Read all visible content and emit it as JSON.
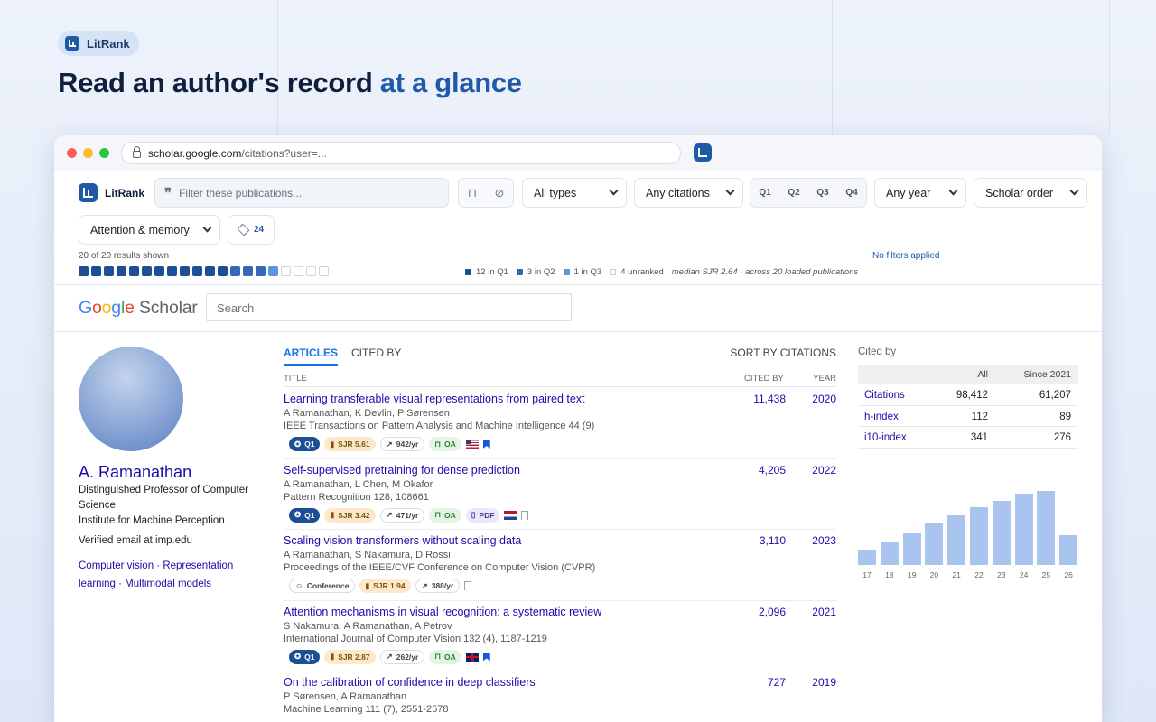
{
  "badge": {
    "label": "LitRank"
  },
  "hero": {
    "title_start": "Read an author's record",
    "title_accent": "at a glance"
  },
  "browser": {
    "url_host": "scholar.google.com",
    "url_path": "/citations?user=..."
  },
  "toolbar": {
    "brand": "LitRank",
    "filter_placeholder": "Filter these publications...",
    "type_select": "All types",
    "citations_select": "Any citations",
    "quartiles": [
      "Q1",
      "Q2",
      "Q3",
      "Q4"
    ],
    "year_select": "Any year",
    "order_select": "Scholar order",
    "topic_select": "Attention & memory",
    "layer_count": "24",
    "results_text": "20 of 20 results shown",
    "no_filters": "No filters applied",
    "squares": {
      "q1": 12,
      "q2": 3,
      "q3": 1,
      "unranked": 4
    },
    "legend": {
      "q1": "12 in Q1",
      "q2": "3 in Q2",
      "q3": "1 in Q3",
      "unranked": "4 unranked",
      "median": "median SJR 2.64 · across 20 loaded publications"
    },
    "colors": {
      "q1": "#1d4f96",
      "q2": "#3469b6",
      "q3": "#5d95e0",
      "unranked": "#ffffff"
    }
  },
  "scholar": {
    "logo_google": "Google",
    "logo_scholar": "Scholar",
    "search_placeholder": "Search"
  },
  "profile": {
    "name": "A. Ramanathan",
    "title": "Distinguished Professor of Computer Science,",
    "institute": "Institute for Machine Perception",
    "verified": "Verified email at imp.edu",
    "interests": [
      "Computer vision",
      "Representation learning",
      "Multimodal models"
    ]
  },
  "articles": {
    "tabs": {
      "articles": "ARTICLES",
      "cited_by": "CITED BY",
      "sort": "SORT BY CITATIONS"
    },
    "headers": {
      "title": "TITLE",
      "cited_by": "CITED BY",
      "year": "YEAR"
    },
    "rows": [
      {
        "title": "Learning transferable visual representations from paired text",
        "authors": "A Ramanathan, K Devlin, P Sørensen",
        "venue": "IEEE Transactions on Pattern Analysis and Machine Intelligence 44 (9)",
        "cites": "11,438",
        "year": "2020",
        "q": "Q1",
        "sjr": "SJR 5.61",
        "rate": "942/yr",
        "oa": "OA",
        "pdf": "",
        "conf": "",
        "flag": "us",
        "saved": true
      },
      {
        "title": "Self-supervised pretraining for dense prediction",
        "authors": "A Ramanathan, L Chen, M Okafor",
        "venue": "Pattern Recognition 128, 108661",
        "cites": "4,205",
        "year": "2022",
        "q": "Q1",
        "sjr": "SJR 3.42",
        "rate": "471/yr",
        "oa": "OA",
        "pdf": "PDF",
        "conf": "",
        "flag": "nl",
        "saved": false
      },
      {
        "title": "Scaling vision transformers without scaling data",
        "authors": "A Ramanathan, S Nakamura, D Rossi",
        "venue": "Proceedings of the IEEE/CVF Conference on Computer Vision (CVPR)",
        "cites": "3,110",
        "year": "2023",
        "q": "",
        "sjr": "SJR 1.94",
        "rate": "388/yr",
        "oa": "",
        "pdf": "",
        "conf": "Conference",
        "flag": "",
        "saved": false
      },
      {
        "title": "Attention mechanisms in visual recognition: a systematic review",
        "authors": "S Nakamura, A Ramanathan, A Petrov",
        "venue": "International Journal of Computer Vision 132 (4), 1187-1219",
        "cites": "2,096",
        "year": "2021",
        "q": "Q1",
        "sjr": "SJR 2.87",
        "rate": "262/yr",
        "oa": "OA",
        "pdf": "",
        "conf": "",
        "flag": "uk",
        "saved": true
      },
      {
        "title": "On the calibration of confidence in deep classifiers",
        "authors": "P Sørensen, A Ramanathan",
        "venue": "Machine Learning 111 (7), 2551-2578",
        "cites": "727",
        "year": "2019",
        "q": "",
        "sjr": "",
        "rate": "",
        "oa": "",
        "pdf": "",
        "conf": "",
        "flag": "",
        "saved": false
      }
    ]
  },
  "cited": {
    "label": "Cited by",
    "headers": {
      "all": "All",
      "since": "Since 2021"
    },
    "rows": [
      {
        "name": "Citations",
        "all": "98,412",
        "since": "61,207"
      },
      {
        "name": "h-index",
        "all": "112",
        "since": "89"
      },
      {
        "name": "i10-index",
        "all": "341",
        "since": "276"
      }
    ],
    "hist_years": [
      "17",
      "18",
      "19",
      "20",
      "21",
      "22",
      "23",
      "24",
      "25",
      "26"
    ],
    "hist_values": [
      17,
      25,
      35,
      46,
      55,
      64,
      71,
      79,
      82,
      33
    ],
    "hist_max": 90
  }
}
